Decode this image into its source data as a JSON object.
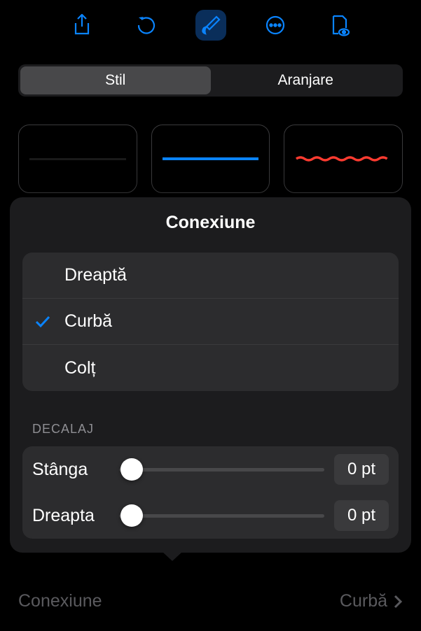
{
  "tabs": {
    "style": "Stil",
    "arrange": "Aranjare"
  },
  "popover": {
    "title": "Conexiune",
    "options": {
      "straight": "Dreaptă",
      "curve": "Curbă",
      "corner": "Colț"
    },
    "decalajHeader": "DECALAJ",
    "left": {
      "label": "Stânga",
      "value": "0 pt"
    },
    "right": {
      "label": "Dreapta",
      "value": "0 pt"
    }
  },
  "bottom": {
    "label": "Conexiune",
    "value": "Curbă"
  }
}
